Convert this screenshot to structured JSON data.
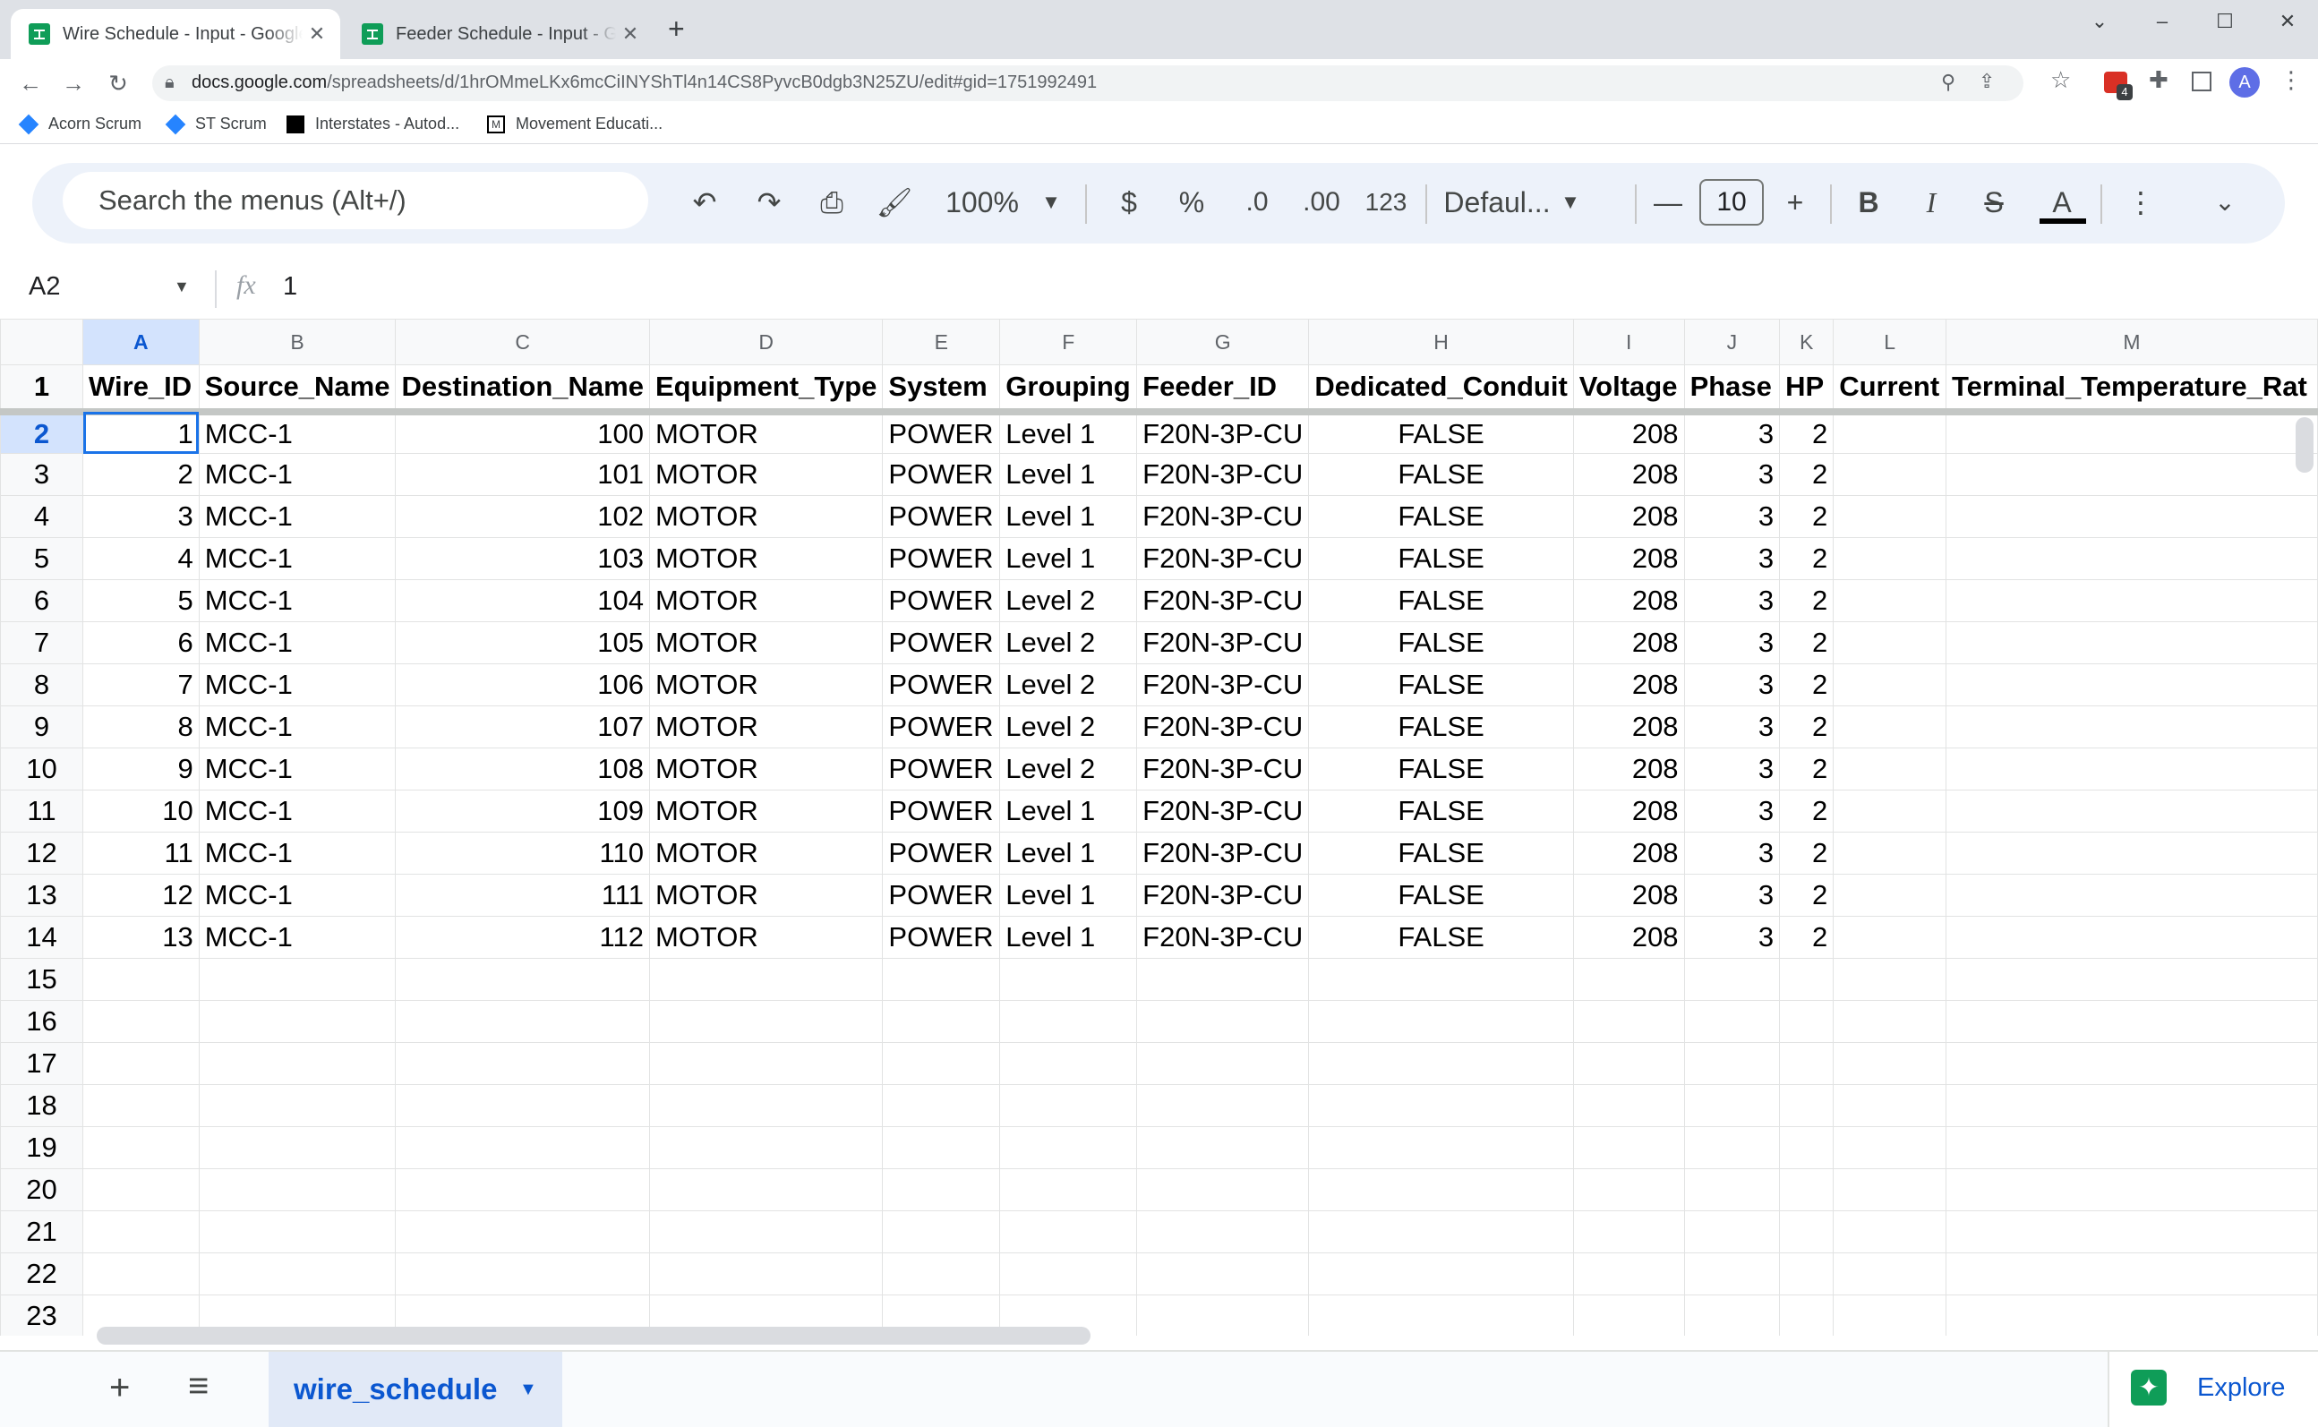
{
  "browser": {
    "tabs": [
      {
        "title": "Wire Schedule - Input - Google Sheets",
        "active": true
      },
      {
        "title": "Feeder Schedule - Input - Google Sheets",
        "active": false
      }
    ],
    "url_host": "docs.google.com",
    "url_path": "/spreadsheets/d/1hrOMmeLKx6mcCiINYShTl4n14CS8PyvcB0dgb3N25ZU/edit#gid=1751992491",
    "bookmarks": [
      "Acorn Scrum",
      "ST Scrum",
      "Interstates - Autod...",
      "Movement Educati..."
    ],
    "extension_badge": "4",
    "profile_initial": "A"
  },
  "toolbar": {
    "search_placeholder": "Search the menus (Alt+/)",
    "zoom": "100%",
    "currency": "$",
    "percent": "%",
    "dec_decrease": ".0",
    "dec_increase": ".00",
    "number_format": "123",
    "font": "Defaul...",
    "font_size": "10",
    "bold": "B",
    "italic": "I",
    "text_color": "A"
  },
  "formula_bar": {
    "cell_ref": "A2",
    "fx": "fx",
    "value": "1"
  },
  "grid": {
    "column_letters": [
      "A",
      "B",
      "C",
      "D",
      "E",
      "F",
      "G",
      "H",
      "I",
      "J",
      "K",
      "L",
      "M"
    ],
    "headers": [
      "Wire_ID",
      "Source_Name",
      "Destination_Name",
      "Equipment_Type",
      "System",
      "Grouping",
      "Feeder_ID",
      "Dedicated_Conduit",
      "Voltage",
      "Phase",
      "HP",
      "Current",
      "Terminal_Temperature_Rat"
    ],
    "rows": [
      [
        "1",
        "MCC-1",
        "100",
        "MOTOR",
        "POWER",
        "Level 1",
        "F20N-3P-CU",
        "FALSE",
        "208",
        "3",
        "2",
        "",
        ""
      ],
      [
        "2",
        "MCC-1",
        "101",
        "MOTOR",
        "POWER",
        "Level 1",
        "F20N-3P-CU",
        "FALSE",
        "208",
        "3",
        "2",
        "",
        ""
      ],
      [
        "3",
        "MCC-1",
        "102",
        "MOTOR",
        "POWER",
        "Level 1",
        "F20N-3P-CU",
        "FALSE",
        "208",
        "3",
        "2",
        "",
        ""
      ],
      [
        "4",
        "MCC-1",
        "103",
        "MOTOR",
        "POWER",
        "Level 1",
        "F20N-3P-CU",
        "FALSE",
        "208",
        "3",
        "2",
        "",
        ""
      ],
      [
        "5",
        "MCC-1",
        "104",
        "MOTOR",
        "POWER",
        "Level 2",
        "F20N-3P-CU",
        "FALSE",
        "208",
        "3",
        "2",
        "",
        ""
      ],
      [
        "6",
        "MCC-1",
        "105",
        "MOTOR",
        "POWER",
        "Level 2",
        "F20N-3P-CU",
        "FALSE",
        "208",
        "3",
        "2",
        "",
        ""
      ],
      [
        "7",
        "MCC-1",
        "106",
        "MOTOR",
        "POWER",
        "Level 2",
        "F20N-3P-CU",
        "FALSE",
        "208",
        "3",
        "2",
        "",
        ""
      ],
      [
        "8",
        "MCC-1",
        "107",
        "MOTOR",
        "POWER",
        "Level 2",
        "F20N-3P-CU",
        "FALSE",
        "208",
        "3",
        "2",
        "",
        ""
      ],
      [
        "9",
        "MCC-1",
        "108",
        "MOTOR",
        "POWER",
        "Level 2",
        "F20N-3P-CU",
        "FALSE",
        "208",
        "3",
        "2",
        "",
        ""
      ],
      [
        "10",
        "MCC-1",
        "109",
        "MOTOR",
        "POWER",
        "Level 1",
        "F20N-3P-CU",
        "FALSE",
        "208",
        "3",
        "2",
        "",
        ""
      ],
      [
        "11",
        "MCC-1",
        "110",
        "MOTOR",
        "POWER",
        "Level 1",
        "F20N-3P-CU",
        "FALSE",
        "208",
        "3",
        "2",
        "",
        ""
      ],
      [
        "12",
        "MCC-1",
        "111",
        "MOTOR",
        "POWER",
        "Level 1",
        "F20N-3P-CU",
        "FALSE",
        "208",
        "3",
        "2",
        "",
        ""
      ],
      [
        "13",
        "MCC-1",
        "112",
        "MOTOR",
        "POWER",
        "Level 1",
        "F20N-3P-CU",
        "FALSE",
        "208",
        "3",
        "2",
        "",
        ""
      ]
    ],
    "row_numbers": [
      "1",
      "2",
      "3",
      "4",
      "5",
      "6",
      "7",
      "8",
      "9",
      "10",
      "11",
      "12",
      "13",
      "14",
      "15",
      "16",
      "17",
      "18",
      "19",
      "20",
      "21",
      "22",
      "23"
    ]
  },
  "bottom": {
    "add_sheet": "+",
    "all_sheets": "≡",
    "sheet_name": "wire_schedule",
    "explore": "Explore"
  },
  "colors": {
    "accent": "#0b57d0",
    "selection": "#1a73e8",
    "sheets_green": "#0f9d58"
  }
}
